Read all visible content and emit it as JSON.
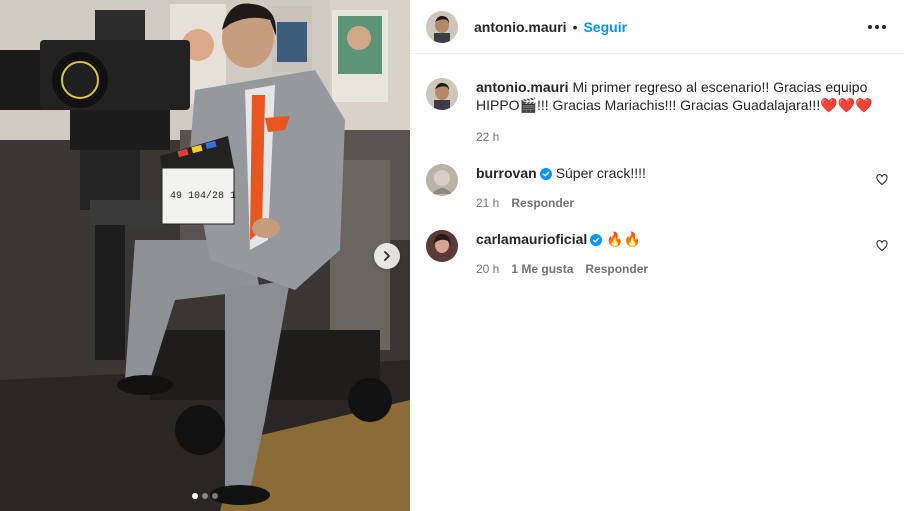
{
  "post": {
    "author": "antonio.mauri",
    "separator": "•",
    "follow_label": "Seguir",
    "more_icon": "more-options-icon"
  },
  "caption": {
    "username": "antonio.mauri",
    "text": "Mi primer regreso al escenario!! Gracias equipo HIPPO🎬!!! Gracias Mariachis!!! Gracias Guadalajara!!!",
    "hearts": "❤️❤️❤️",
    "time": "22 h"
  },
  "comments": [
    {
      "username": "burrovan",
      "verified": true,
      "text": "Súper crack!!!!",
      "time": "21 h",
      "likes": "",
      "reply_label": "Responder"
    },
    {
      "username": "carlamaurioficial",
      "verified": true,
      "text": "🔥🔥",
      "time": "20 h",
      "likes": "1 Me gusta",
      "reply_label": "Responder"
    }
  ],
  "carousel": {
    "total": 3,
    "active_index": 0,
    "clapper_text": "49  104/28  1"
  },
  "colors": {
    "accent": "#0095f6",
    "verified": "#0095f6",
    "heart": "#e0202c",
    "suit": "#8e9195",
    "tie": "#e8551e"
  }
}
